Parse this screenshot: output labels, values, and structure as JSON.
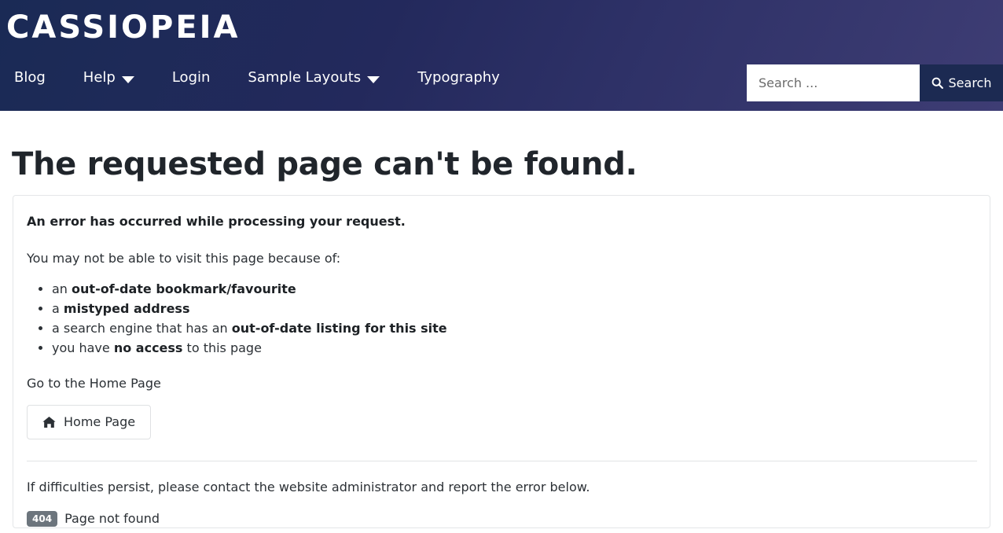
{
  "header": {
    "brand": "CASSIOPEIA",
    "nav": [
      {
        "label": "Blog",
        "has_caret": false
      },
      {
        "label": "Help",
        "has_caret": true
      },
      {
        "label": "Login",
        "has_caret": false
      },
      {
        "label": "Sample Layouts",
        "has_caret": true
      },
      {
        "label": "Typography",
        "has_caret": false
      }
    ],
    "search": {
      "placeholder": "Search ...",
      "value": "",
      "button_label": "Search",
      "icon": "search-icon"
    },
    "colors": {
      "gradient_start": "#1a2a55",
      "gradient_end": "#3e3d74",
      "button_bg": "#1c2a52"
    }
  },
  "main": {
    "page_title": "The requested page can't be found.",
    "error_lead": "An error has occurred while processing your request.",
    "error_sub": "You may not be able to visit this page because of:",
    "reasons": [
      {
        "pre": "an ",
        "bold": "out-of-date bookmark/favourite",
        "post": ""
      },
      {
        "pre": "a ",
        "bold": "mistyped address",
        "post": ""
      },
      {
        "pre": "a search engine that has an ",
        "bold": "out-of-date listing for this site",
        "post": ""
      },
      {
        "pre": "you have ",
        "bold": "no access",
        "post": " to this page"
      }
    ],
    "home_lead": "Go to the Home Page",
    "home_button": {
      "label": "Home Page",
      "icon": "home-icon"
    },
    "persist_text": "If difficulties persist, please contact the website administrator and report the error below.",
    "error_code": "404",
    "error_message": "Page not found",
    "badge_color": "#6c757d"
  }
}
